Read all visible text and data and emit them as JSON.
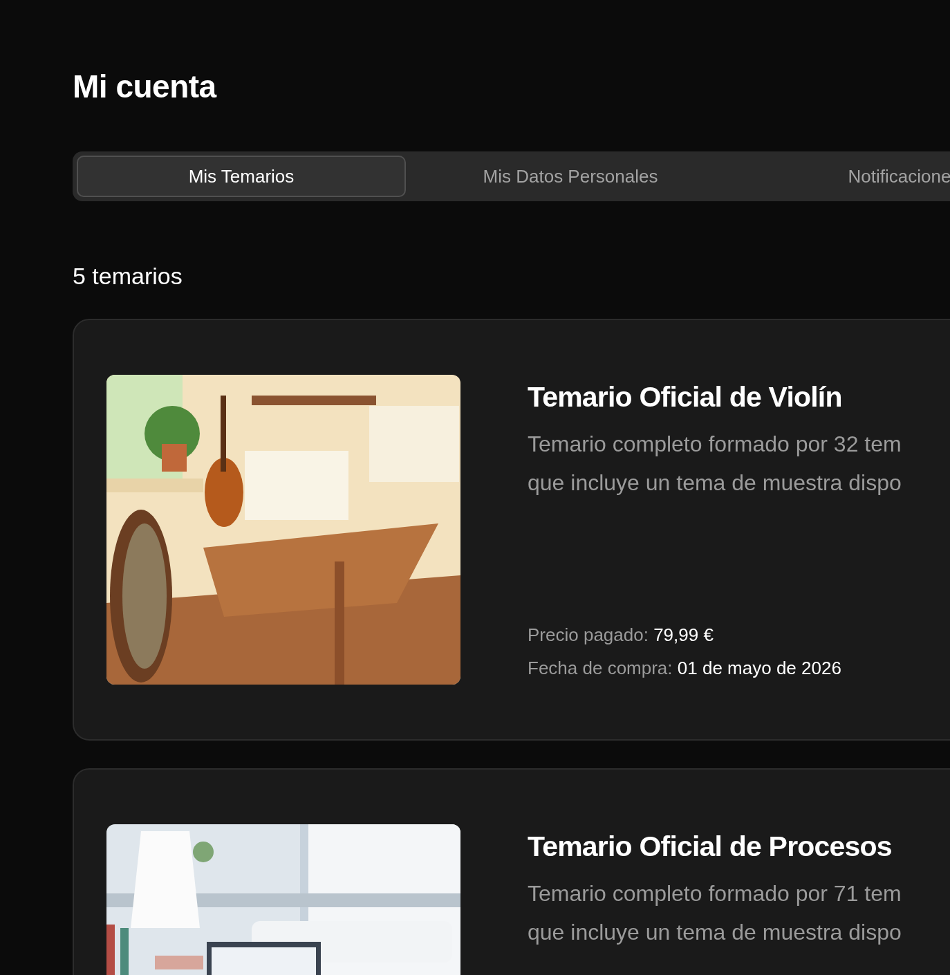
{
  "page_title": "Mi cuenta",
  "tabs": [
    {
      "label": "Mis Temarios",
      "selected": true
    },
    {
      "label": "Mis Datos Personales",
      "selected": false
    },
    {
      "label": "Notificacione",
      "selected": false
    }
  ],
  "count": "5 temarios",
  "courses": [
    {
      "image": {
        "kind": "picture"
      },
      "title": "Temario Oficial de Violín",
      "description_lines": [
        "Temario completo formado por 32 tem",
        "que incluye un tema de muestra dispo"
      ],
      "price_label": "Precio pagado:",
      "price": "79,99 €",
      "date_label": "Fecha de compra:",
      "date": "01 de mayo de 2026"
    },
    {
      "image": {
        "kind": "picture"
      },
      "title": "Temario Oficial de Procesos",
      "description_lines": [
        "Temario completo formado por 71 tem",
        "que incluye un tema de muestra dispo"
      ]
    }
  ]
}
